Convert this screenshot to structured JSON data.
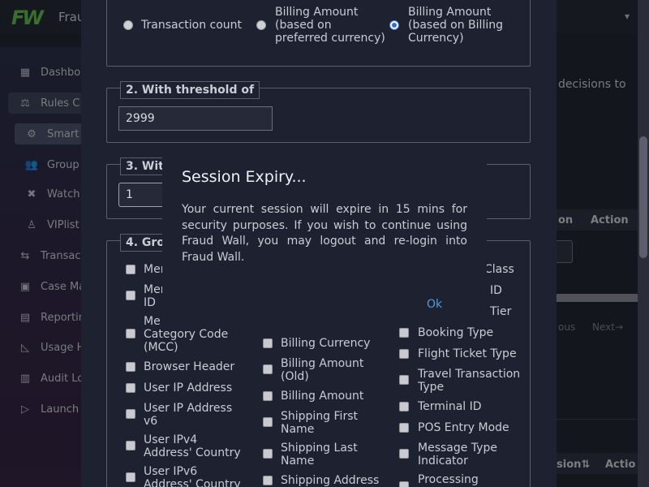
{
  "app": {
    "title": "Frau",
    "logo_text": "FW",
    "user_caret": "▾"
  },
  "sidebar": {
    "items": [
      {
        "label": "Dashbo",
        "icon": "dashboard-icon"
      },
      {
        "label": "Rules C",
        "icon": "rules-icon"
      },
      {
        "label": "Smart",
        "icon": "smart-rules-icon"
      },
      {
        "label": "Group",
        "icon": "group-icon"
      },
      {
        "label": "Watch",
        "icon": "watchlist-icon"
      },
      {
        "label": "VIPlist",
        "icon": "viplist-icon"
      },
      {
        "label": "Transac",
        "icon": "transactions-icon"
      },
      {
        "label": "Case Ma",
        "icon": "case-management-icon"
      },
      {
        "label": "Reportin",
        "icon": "reporting-icon"
      },
      {
        "label": "Usage H",
        "icon": "usage-history-icon"
      },
      {
        "label": "Audit Lo",
        "icon": "audit-log-icon"
      },
      {
        "label": "Launch",
        "icon": "launch-icon"
      }
    ]
  },
  "background": {
    "decisions_text": "decisions to",
    "col_on": "on",
    "col_action": "Action",
    "pager_prev": "ous",
    "pager_next": "Next→",
    "col_sion": "sion⇅",
    "col_actio": "Actio"
  },
  "section1": {
    "options": [
      {
        "label": "Transaction count",
        "selected": false
      },
      {
        "label": "Billing Amount\n(based on\npreferred currency)",
        "selected": false
      },
      {
        "label": "Billing Amount\n(based on Billing\nCurrency)",
        "selected": true
      }
    ]
  },
  "section2": {
    "legend": "2. With threshold of",
    "value": "2999"
  },
  "section3": {
    "legend": "3. Wit",
    "value": "1"
  },
  "section4": {
    "legend": "4. Gro",
    "col1": [
      "Mer",
      "Mer\nID",
      "Me\nCategory Code\n(MCC)",
      "Browser Header",
      "User IP Address",
      "User IP Address\nv6",
      "User IPv4\nAddress' Country",
      "User IPv6\nAddress' Country"
    ],
    "col2": [
      "Billing Currency",
      "Billing Amount\n(Old)",
      "Billing Amount",
      "Shipping First\nName",
      "Shipping Last\nName",
      "Shipping Address"
    ],
    "col3_partial": [
      "Class",
      "ID",
      "Tier"
    ],
    "col3": [
      "Booking Type",
      "Flight Ticket Type",
      "Travel Transaction\nType",
      "Terminal ID",
      "POS Entry Mode",
      "Message Type\nIndicator",
      "Processing"
    ]
  },
  "modal": {
    "title": "Session Expiry...",
    "body": "Your current session will expire in 15 mins for security purposes. If you wish to continue using Fraud Wall, you may logout and re-login into Fraud Wall.",
    "ok_label": "Ok"
  }
}
